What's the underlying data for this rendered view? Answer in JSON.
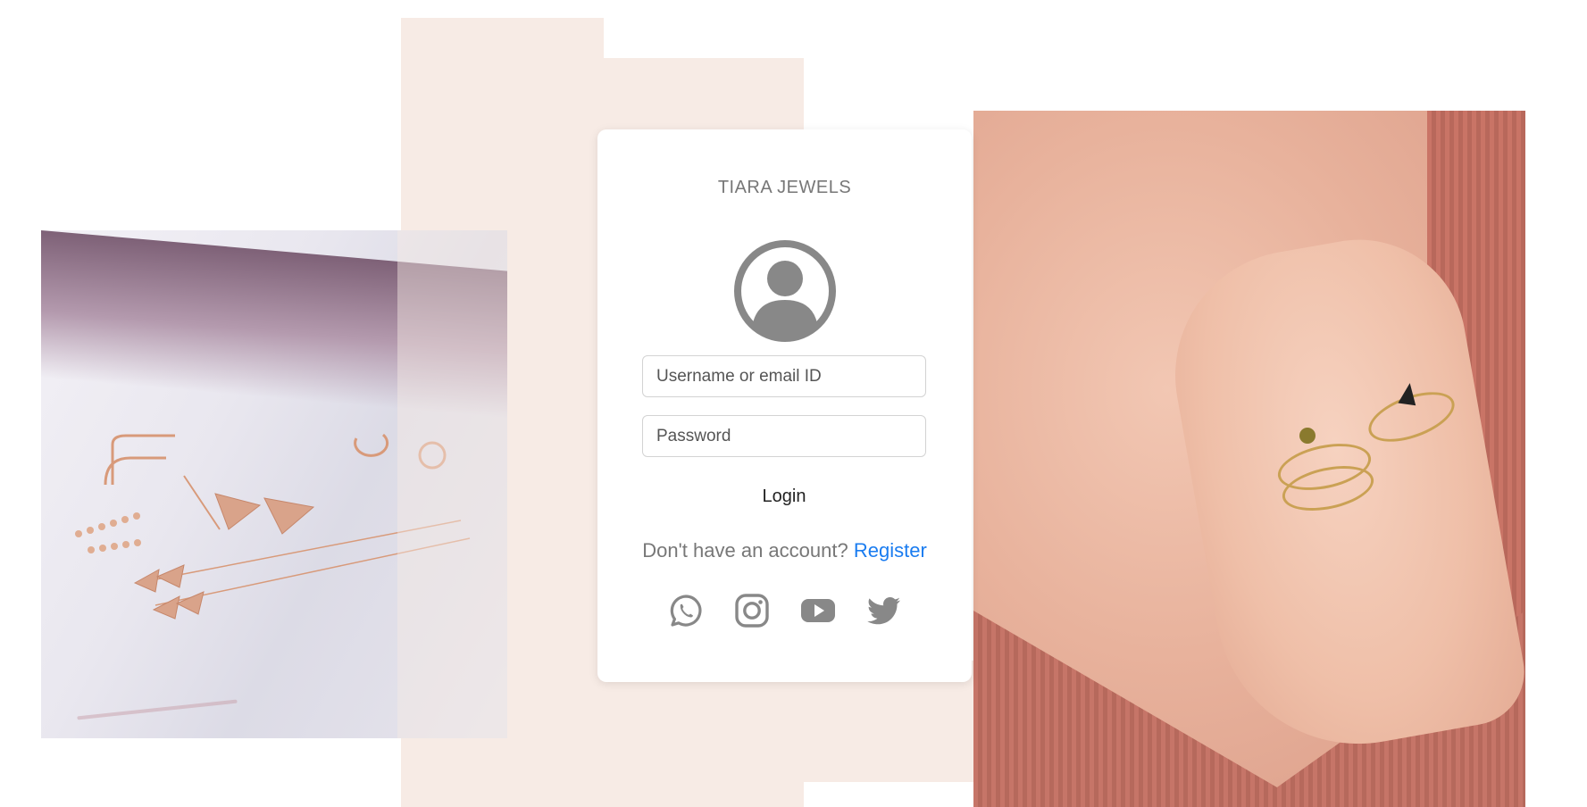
{
  "brand": {
    "name": "TIARA JEWELS"
  },
  "login": {
    "username_placeholder": "Username or email ID",
    "password_placeholder": "Password",
    "login_label": "Login",
    "no_account_text": "Don't have an account?",
    "register_label": "Register"
  },
  "social_links": [
    "whatsapp-icon",
    "instagram-icon",
    "youtube-icon",
    "twitter-icon"
  ],
  "colors": {
    "accent_background": "#f7ebe5",
    "icon_gray": "#888888",
    "link_blue": "#1a7cf0",
    "text_gray": "#777777"
  }
}
